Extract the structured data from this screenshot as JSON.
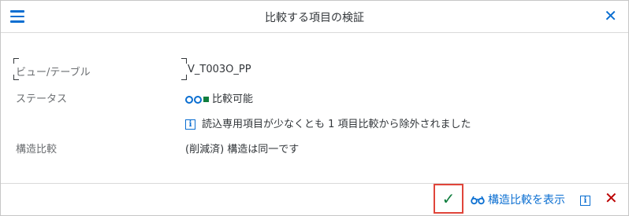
{
  "dialog": {
    "title": "比較する項目の検証",
    "menu_icon": "hamburger-menu-icon",
    "close_icon": "close-icon",
    "close_glyph": "✕"
  },
  "fields": {
    "view_table": {
      "label": "ビュー/テーブル",
      "value": "V_T003O_PP"
    },
    "status": {
      "label": "ステータス",
      "value": "比較可能",
      "icon": "status-lights-icon",
      "info_icon": "info-icon",
      "message": "読込専用項目が少なくとも 1 項目比較から除外されました"
    },
    "structure_compare": {
      "label": "構造比較",
      "value": "(削減済) 構造は同一です"
    }
  },
  "footer": {
    "ok_icon": "checkmark-icon",
    "ok_glyph": "✓",
    "compare_button": {
      "label": "構造比較を表示",
      "icon": "glasses-icon"
    },
    "info_icon": "info-icon",
    "cancel_icon": "cancel-icon",
    "cancel_glyph": "✕"
  },
  "colors": {
    "accent": "#0a6ed1",
    "success": "#107e3e",
    "cancel": "#bb0000",
    "highlight_border": "#e0453a"
  }
}
